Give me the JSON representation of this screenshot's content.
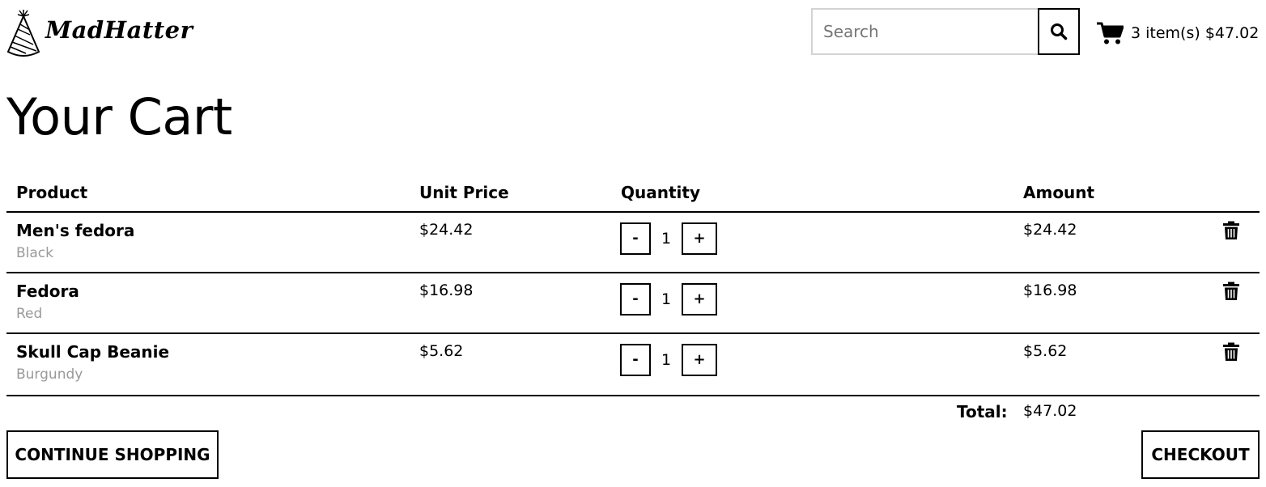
{
  "header": {
    "logo_text": "MadHatter",
    "search": {
      "placeholder": "Search",
      "value": ""
    },
    "cart_summary": "3 item(s) $47.02"
  },
  "page_title": "Your Cart",
  "table": {
    "columns": [
      "Product",
      "Unit Price",
      "Quantity",
      "Amount"
    ],
    "rows": [
      {
        "name": "Men's fedora",
        "variant": "Black",
        "unit_price": "$24.42",
        "quantity": "1",
        "amount": "$24.42",
        "minus": "-",
        "plus": "+"
      },
      {
        "name": "Fedora",
        "variant": "Red",
        "unit_price": "$16.98",
        "quantity": "1",
        "amount": "$16.98",
        "minus": "-",
        "plus": "+"
      },
      {
        "name": "Skull Cap Beanie",
        "variant": "Burgundy",
        "unit_price": "$5.62",
        "quantity": "1",
        "amount": "$5.62",
        "minus": "-",
        "plus": "+"
      }
    ]
  },
  "totals": {
    "label": "Total:",
    "value": "$47.02"
  },
  "buttons": {
    "continue": "CONTINUE SHOPPING",
    "checkout": "CHECKOUT"
  },
  "icons": {
    "logo": "party-hat-icon",
    "search": "search-icon",
    "cart": "cart-icon",
    "delete": "trash-icon"
  }
}
